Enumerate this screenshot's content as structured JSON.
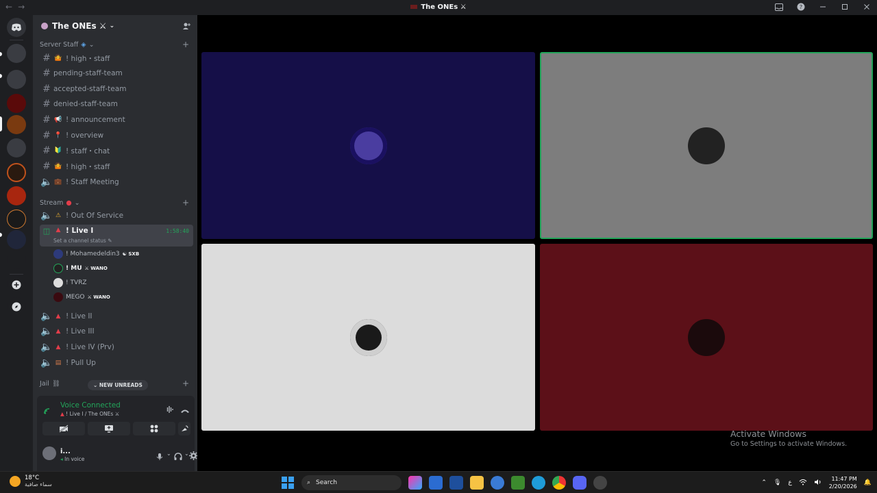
{
  "window": {
    "title": "The ONEs ⚔"
  },
  "server": {
    "name": "The ONEs ⚔"
  },
  "categories": [
    {
      "label": "Server Staff"
    },
    {
      "label": "Stream"
    },
    {
      "label": "Jail"
    }
  ],
  "staff_channels": [
    {
      "name": "! high・staff",
      "emoji": "🤷"
    },
    {
      "name": "pending-staff-team",
      "emoji": ""
    },
    {
      "name": "accepted-staff-team",
      "emoji": ""
    },
    {
      "name": "denied-staff-team",
      "emoji": ""
    },
    {
      "name": "! announcement",
      "emoji": "📢"
    },
    {
      "name": "! overview",
      "emoji": "📍"
    },
    {
      "name": "! staff・chat",
      "emoji": "🔰"
    },
    {
      "name": "! high・staff",
      "emoji": "🤷"
    },
    {
      "name": "! Staff Meeting",
      "emoji": "💼"
    }
  ],
  "stream_channels": {
    "out_of_service": "! Out Of Service",
    "live1": {
      "name": "! Live I",
      "timer": "1:58:40",
      "status": "Set a channel status"
    },
    "others": [
      "! Live II",
      "! Live III",
      "! Live IV (Prv)",
      "! Pull Up"
    ]
  },
  "voice_users": [
    {
      "name": "! Mohamedeldin3",
      "tag": "SXB"
    },
    {
      "name": "! MU",
      "tag": "WANO"
    },
    {
      "name": "! TVRZ",
      "tag": ""
    },
    {
      "name": "MEGO",
      "tag": "WANO"
    }
  ],
  "new_unreads": "NEW UNREADS",
  "voice_panel": {
    "status": "Voice Connected",
    "location": "! Live I / The ONEs ⚔"
  },
  "user": {
    "name": "i...",
    "status": "In voice"
  },
  "watermark": {
    "line1": "Activate Windows",
    "line2": "Go to Settings to activate Windows."
  },
  "taskbar": {
    "temp": "18°C",
    "weather": "سماء صافية",
    "search": "Search",
    "lang": "ع",
    "time": "11:47 PM",
    "date": "2/20/2026"
  },
  "colors": {
    "tile1": "#150f48",
    "tile2": "#7d7d7d",
    "tile3": "#dcdcdc",
    "tile4": "#5c1018",
    "speaking": "#23a55a"
  }
}
